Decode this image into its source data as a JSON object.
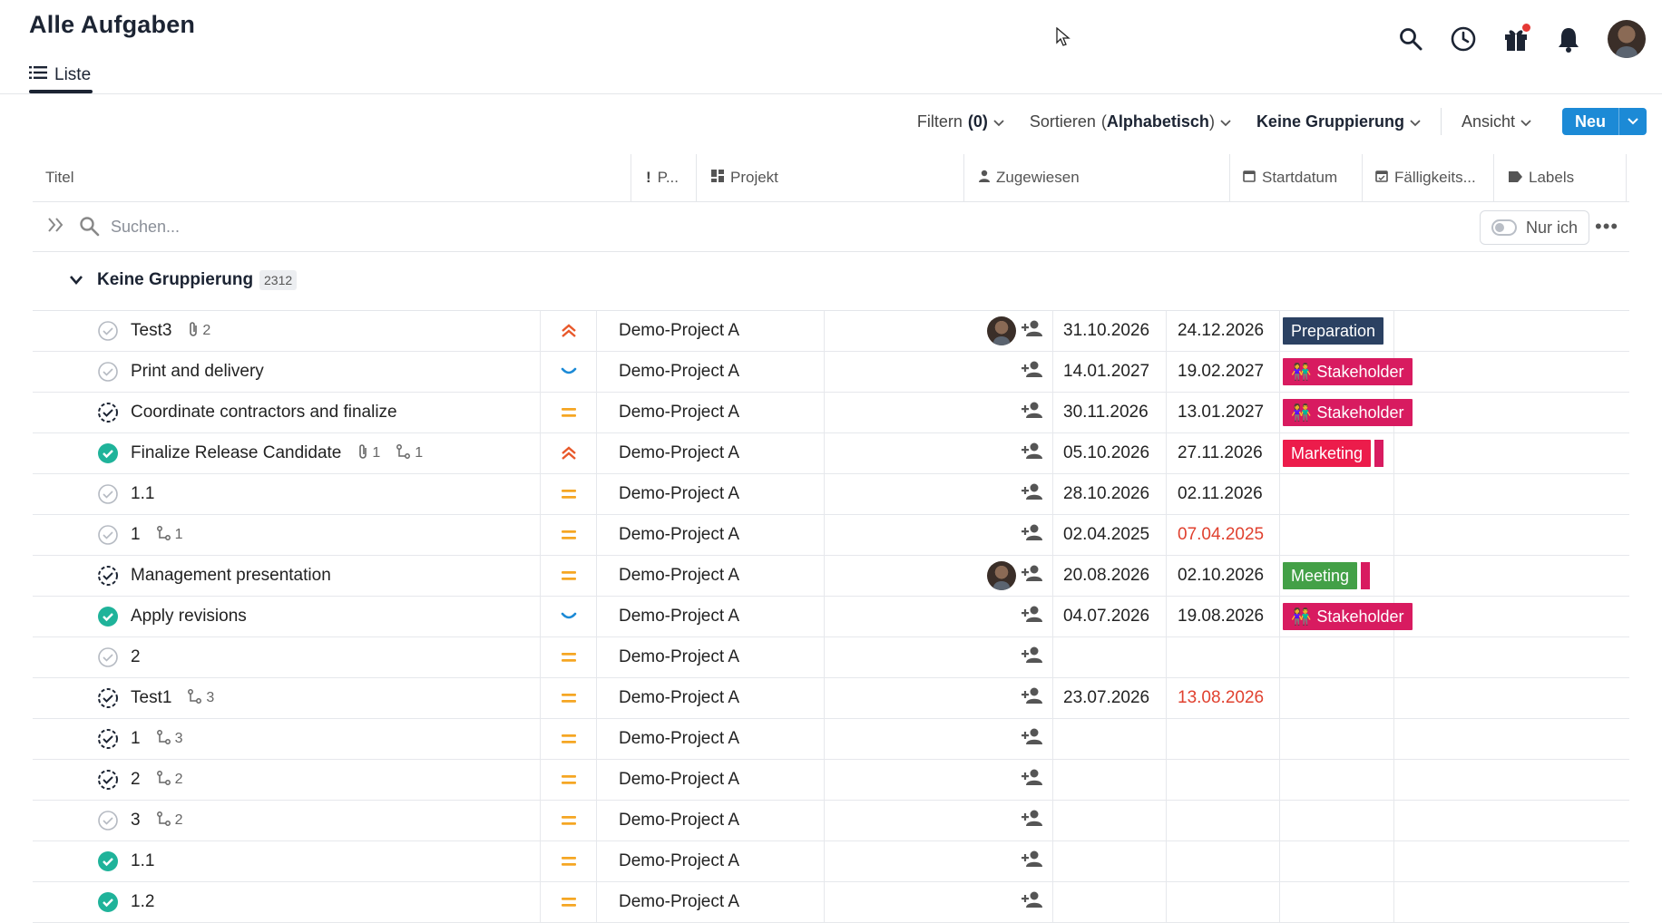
{
  "header": {
    "title": "Alle Aufgaben",
    "tab_label": "Liste"
  },
  "toolbar": {
    "filter_label": "Filtern",
    "filter_count": "(0)",
    "sort_label": "Sortieren",
    "sort_value": "Alphabetisch",
    "group_label": "Keine Gruppierung",
    "view_label": "Ansicht",
    "new_label": "Neu"
  },
  "columns": {
    "title": "Titel",
    "priority": "P...",
    "project": "Projekt",
    "assigned": "Zugewiesen",
    "start": "Startdatum",
    "due": "Fälligkeits...",
    "labels": "Labels"
  },
  "search": {
    "placeholder": "Suchen...",
    "only_me": "Nur ich"
  },
  "group": {
    "label": "Keine Gruppierung",
    "count": "2312"
  },
  "colors": {
    "accent": "#1c8ad6",
    "done": "#1fb39a",
    "prio_high": "#e8582a",
    "prio_medium": "#f5a623",
    "prio_low": "#1c8ad6",
    "overdue": "#e0412f",
    "label_preparation": "#2b4162",
    "label_stakeholder": "#d81b60",
    "label_marketing": "#ec1c4b",
    "label_meeting": "#43a047"
  },
  "rows": [
    {
      "status": "open",
      "title": "Test3",
      "attach": "2",
      "sub": "",
      "prio": "high",
      "project": "Demo-Project A",
      "avatar": true,
      "start": "31.10.2026",
      "due": "24.12.2026",
      "overdue": false,
      "label": "Preparation",
      "label_color": "#2b4162",
      "label_emoji": "",
      "label_extra": ""
    },
    {
      "status": "open",
      "title": "Print and delivery",
      "attach": "",
      "sub": "",
      "prio": "low",
      "project": "Demo-Project A",
      "avatar": false,
      "start": "14.01.2027",
      "due": "19.02.2027",
      "overdue": false,
      "label": "Stakeholder",
      "label_color": "#d81b60",
      "label_emoji": "👫",
      "label_extra": ""
    },
    {
      "status": "progress",
      "title": "Coordinate contractors and finalize",
      "attach": "",
      "sub": "",
      "prio": "medium",
      "project": "Demo-Project A",
      "avatar": false,
      "start": "30.11.2026",
      "due": "13.01.2027",
      "overdue": false,
      "label": "Stakeholder",
      "label_color": "#d81b60",
      "label_emoji": "👫",
      "label_extra": ""
    },
    {
      "status": "done",
      "title": "Finalize Release Candidate",
      "attach": "1",
      "sub": "1",
      "prio": "high",
      "project": "Demo-Project A",
      "avatar": false,
      "start": "05.10.2026",
      "due": "27.11.2026",
      "overdue": false,
      "label": "Marketing",
      "label_color": "#ec1c4b",
      "label_emoji": "",
      "label_extra": "#d81b60"
    },
    {
      "status": "open",
      "title": "1.1",
      "attach": "",
      "sub": "",
      "prio": "medium",
      "project": "Demo-Project A",
      "avatar": false,
      "start": "28.10.2026",
      "due": "02.11.2026",
      "overdue": false,
      "label": "",
      "label_color": "",
      "label_emoji": "",
      "label_extra": ""
    },
    {
      "status": "open",
      "title": "1",
      "attach": "",
      "sub": "1",
      "prio": "medium",
      "project": "Demo-Project A",
      "avatar": false,
      "start": "02.04.2025",
      "due": "07.04.2025",
      "overdue": true,
      "label": "",
      "label_color": "",
      "label_emoji": "",
      "label_extra": ""
    },
    {
      "status": "progress",
      "title": "Management presentation",
      "attach": "",
      "sub": "",
      "prio": "medium",
      "project": "Demo-Project A",
      "avatar": true,
      "start": "20.08.2026",
      "due": "02.10.2026",
      "overdue": false,
      "label": "Meeting",
      "label_color": "#43a047",
      "label_emoji": "",
      "label_extra": "#d81b60"
    },
    {
      "status": "done",
      "title": "Apply revisions",
      "attach": "",
      "sub": "",
      "prio": "low",
      "project": "Demo-Project A",
      "avatar": false,
      "start": "04.07.2026",
      "due": "19.08.2026",
      "overdue": false,
      "label": "Stakeholder",
      "label_color": "#d81b60",
      "label_emoji": "👫",
      "label_extra": ""
    },
    {
      "status": "open",
      "title": "2",
      "attach": "",
      "sub": "",
      "prio": "medium",
      "project": "Demo-Project A",
      "avatar": false,
      "start": "",
      "due": "",
      "overdue": false,
      "label": "",
      "label_color": "",
      "label_emoji": "",
      "label_extra": ""
    },
    {
      "status": "progress",
      "title": "Test1",
      "attach": "",
      "sub": "3",
      "prio": "medium",
      "project": "Demo-Project A",
      "avatar": false,
      "start": "23.07.2026",
      "due": "13.08.2026",
      "overdue": true,
      "label": "",
      "label_color": "",
      "label_emoji": "",
      "label_extra": ""
    },
    {
      "status": "progress",
      "title": "1",
      "attach": "",
      "sub": "3",
      "prio": "medium",
      "project": "Demo-Project A",
      "avatar": false,
      "start": "",
      "due": "",
      "overdue": false,
      "label": "",
      "label_color": "",
      "label_emoji": "",
      "label_extra": ""
    },
    {
      "status": "progress",
      "title": "2",
      "attach": "",
      "sub": "2",
      "prio": "medium",
      "project": "Demo-Project A",
      "avatar": false,
      "start": "",
      "due": "",
      "overdue": false,
      "label": "",
      "label_color": "",
      "label_emoji": "",
      "label_extra": ""
    },
    {
      "status": "open",
      "title": "3",
      "attach": "",
      "sub": "2",
      "prio": "medium",
      "project": "Demo-Project A",
      "avatar": false,
      "start": "",
      "due": "",
      "overdue": false,
      "label": "",
      "label_color": "",
      "label_emoji": "",
      "label_extra": ""
    },
    {
      "status": "done",
      "title": "1.1",
      "attach": "",
      "sub": "",
      "prio": "medium",
      "project": "Demo-Project A",
      "avatar": false,
      "start": "",
      "due": "",
      "overdue": false,
      "label": "",
      "label_color": "",
      "label_emoji": "",
      "label_extra": ""
    },
    {
      "status": "done",
      "title": "1.2",
      "attach": "",
      "sub": "",
      "prio": "medium",
      "project": "Demo-Project A",
      "avatar": false,
      "start": "",
      "due": "",
      "overdue": false,
      "label": "",
      "label_color": "",
      "label_emoji": "",
      "label_extra": ""
    }
  ]
}
